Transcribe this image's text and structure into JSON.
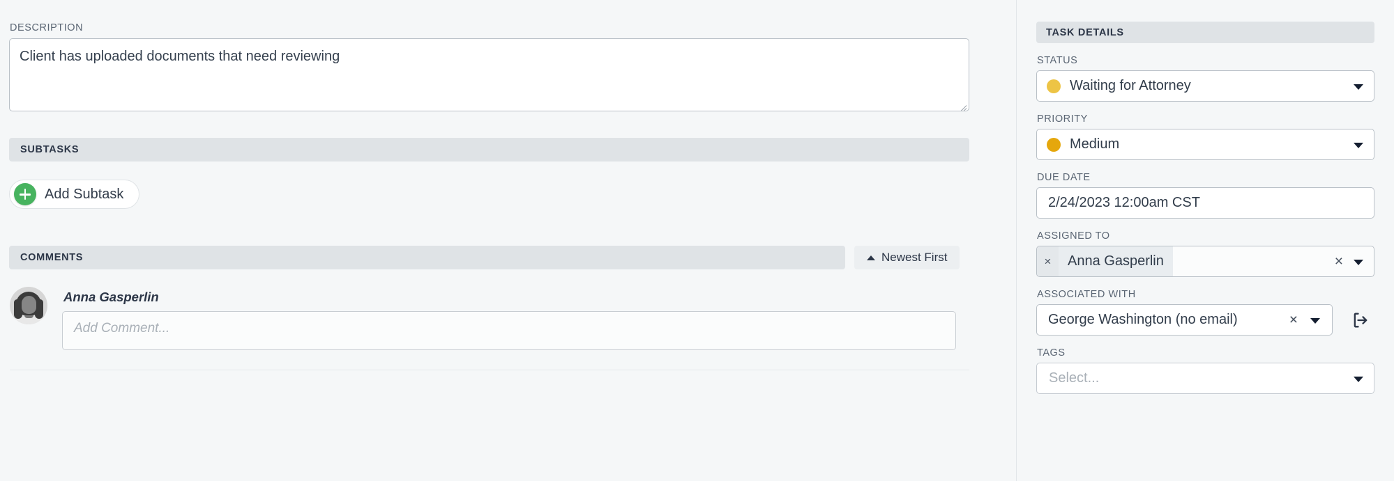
{
  "left": {
    "description": {
      "label": "DESCRIPTION",
      "value": "Client has uploaded documents that need reviewing"
    },
    "subtasks": {
      "header": "SUBTASKS",
      "add_button": "Add Subtask"
    },
    "comments": {
      "header": "COMMENTS",
      "sort_button": "Newest First",
      "author": "Anna Gasperlin",
      "input_placeholder": "Add Comment..."
    }
  },
  "right": {
    "header": "TASK DETAILS",
    "status": {
      "label": "STATUS",
      "value": "Waiting for Attorney",
      "dot_color": "#edc445"
    },
    "priority": {
      "label": "PRIORITY",
      "value": "Medium",
      "dot_color": "#e5a70c"
    },
    "due_date": {
      "label": "DUE DATE",
      "value": "2/24/2023 12:00am CST"
    },
    "assigned_to": {
      "label": "ASSIGNED TO",
      "chip": "Anna Gasperlin",
      "chip_remove": "×",
      "clear": "×"
    },
    "associated_with": {
      "label": "ASSOCIATED WITH",
      "value": "George Washington (no email)",
      "clear": "×"
    },
    "tags": {
      "label": "TAGS",
      "placeholder": "Select..."
    }
  }
}
